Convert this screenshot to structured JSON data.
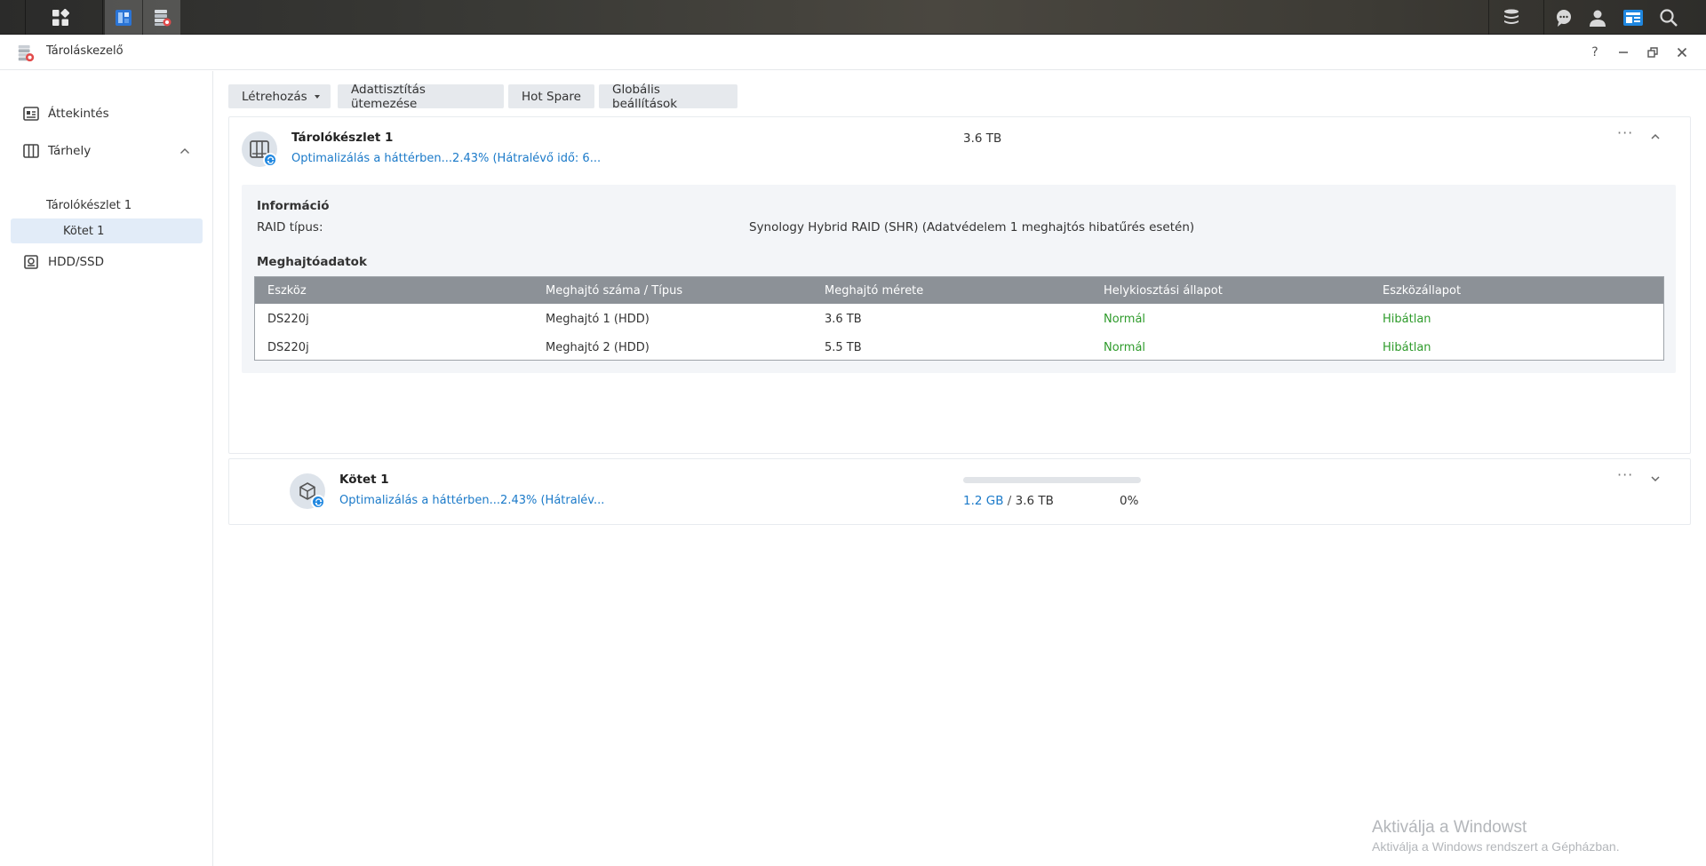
{
  "window": {
    "title": "Tároláskezelő",
    "help": "?",
    "minimize": "–",
    "restore": "⧉",
    "close": "✕"
  },
  "sidebar": {
    "overview": "Áttekintés",
    "storage": "Tárhely",
    "pool": "Tárolókészlet 1",
    "volume": "Kötet 1",
    "hdd": "HDD/SSD"
  },
  "toolbar": {
    "create": "Létrehozás",
    "scrub": "Adattisztítás ütemezése",
    "hotspare": "Hot Spare",
    "global": "Globális beállítások"
  },
  "pool": {
    "name": "Tárolókészlet 1",
    "status": "Optimalizálás a háttérben...2.43% (Hátralévő idő: 6...",
    "size": "3.6 TB",
    "more": "···",
    "info_title": "Információ",
    "raid_label": "RAID típus:",
    "raid_value": "Synology Hybrid RAID (SHR) (Adatvédelem 1 meghajtós hibatűrés esetén)",
    "drives_title": "Meghajtóadatok",
    "drive_columns": [
      "Eszköz",
      "Meghajtó száma / Típus",
      "Meghajtó mérete",
      "Helykiosztási állapot",
      "Eszközállapot"
    ],
    "drives": [
      {
        "device": "DS220j",
        "drive": "Meghajtó 1 (HDD)",
        "size": "3.6 TB",
        "alloc": "Normál",
        "health": "Hibátlan"
      },
      {
        "device": "DS220j",
        "drive": "Meghajtó 2 (HDD)",
        "size": "5.5 TB",
        "alloc": "Normál",
        "health": "Hibátlan"
      }
    ]
  },
  "volume": {
    "name": "Kötet 1",
    "status": "Optimalizálás a háttérben...2.43% (Hátralév...",
    "used": "1.2 GB",
    "sep": "/",
    "total": "3.6 TB",
    "percent": "0%",
    "usage_fraction": 0.0,
    "more": "···"
  },
  "watermark": {
    "line1": "Aktiválja a Windowst",
    "line2": "Aktiválja a Windows rendszert a Gépházban."
  },
  "colors": {
    "accent": "#1f87e0",
    "ok": "#2e9b2b",
    "link": "#1b7ac9"
  }
}
